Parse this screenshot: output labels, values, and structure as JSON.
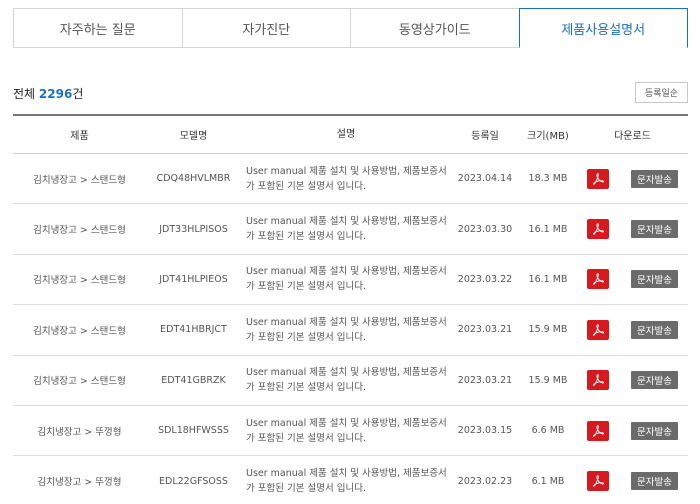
{
  "tabs": [
    {
      "label": "자주하는 질문",
      "active": false
    },
    {
      "label": "자가진단",
      "active": false
    },
    {
      "label": "동영상가이드",
      "active": false
    },
    {
      "label": "제품사용설명서",
      "active": true
    }
  ],
  "summary": {
    "prefix": "전체 ",
    "count": "2296",
    "suffix": "건"
  },
  "sort_button": "등록일순",
  "table": {
    "headers": [
      "제품",
      "모델명",
      "설명",
      "등록일",
      "크기(MB)",
      "다운로드"
    ],
    "rows": [
      {
        "product": "김치냉장고 > 스탠드형",
        "model": "CDQ48HVLMBR",
        "desc": "User manual 제품 설치 및 사용방법, 제품보증서가 포함된 기본 설명서 입니다.",
        "date": "2023.04.14",
        "size": "18.3 MB",
        "sms": "문자발송"
      },
      {
        "product": "김치냉장고 > 스탠드형",
        "model": "JDT33HLPISOS",
        "desc": "User manual 제품 설치 및 사용방법, 제품보증서가 포함된 기본 설명서 입니다.",
        "date": "2023.03.30",
        "size": "16.1 MB",
        "sms": "문자발송"
      },
      {
        "product": "김치냉장고 > 스탠드형",
        "model": "JDT41HLPIEOS",
        "desc": "User manual 제품 설치 및 사용방법, 제품보증서가 포함된 기본 설명서 입니다.",
        "date": "2023.03.22",
        "size": "16.1 MB",
        "sms": "문자발송"
      },
      {
        "product": "김치냉장고 > 스탠드형",
        "model": "EDT41HBRJCT",
        "desc": "User manual 제품 설치 및 사용방법, 제품보증서가 포함된 기본 설명서 입니다.",
        "date": "2023.03.21",
        "size": "15.9 MB",
        "sms": "문자발송"
      },
      {
        "product": "김치냉장고 > 스탠드형",
        "model": "EDT41GBRZK",
        "desc": "User manual 제품 설치 및 사용방법, 제품보증서가 포함된 기본 설명서 입니다.",
        "date": "2023.03.21",
        "size": "15.9 MB",
        "sms": "문자발송"
      },
      {
        "product": "김치냉장고 > 뚜껑형",
        "model": "SDL18HFWSSS",
        "desc": "User manual 제품 설치 및 사용방법, 제품보증서가 포함된 기본 설명서 입니다.",
        "date": "2023.03.15",
        "size": "6.6 MB",
        "sms": "문자발송"
      },
      {
        "product": "김치냉장고 > 뚜껑형",
        "model": "EDL22GFSOSS",
        "desc": "User manual 제품 설치 및 사용방법, 제품보증서가 포함된 기본 설명서 입니다.",
        "date": "2023.02.23",
        "size": "6.1 MB",
        "sms": "문자발송"
      }
    ]
  },
  "icons": {
    "pdf": "pdf-icon"
  },
  "colors": {
    "accent": "#1e6fc4",
    "pdf": "#d6181f",
    "sms_button": "#6b6b6b"
  }
}
